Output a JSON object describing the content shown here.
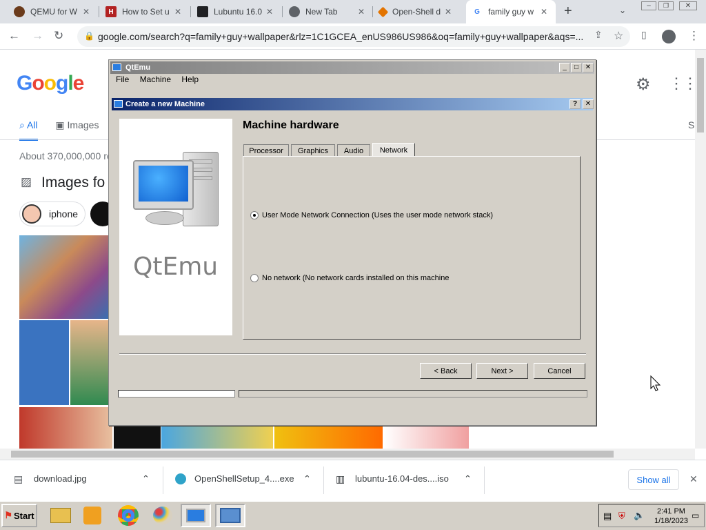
{
  "browser": {
    "tabs": [
      {
        "title": "QEMU for W",
        "fav_color": "#8b3a1a",
        "fav_char": ""
      },
      {
        "title": "How to Set u",
        "fav_color": "#b22222",
        "fav_char": "H"
      },
      {
        "title": "Lubuntu 16.0",
        "fav_color": "#202124",
        "fav_char": ""
      },
      {
        "title": "New Tab",
        "fav_color": "#5f6368",
        "fav_char": ""
      },
      {
        "title": "Open-Shell d",
        "fav_color": "#e37400",
        "fav_char": ""
      },
      {
        "title": "family guy w",
        "fav_color": "#4285f4",
        "fav_char": "G"
      }
    ],
    "url": "google.com/search?q=family+guy+wallpaper&rlz=1C1GCEA_enUS986US986&oq=family+guy+wallpaper&aqs=..."
  },
  "google": {
    "logo": "Google",
    "nav_all": "All",
    "nav_images": "Images",
    "nav_right": "S",
    "about": "About 370,000,000 re",
    "images_for": "Images fo",
    "chip": "iphone"
  },
  "downloads": {
    "items": [
      "download.jpg",
      "OpenShellSetup_4....exe",
      "lubuntu-16.04-des....iso"
    ],
    "show_all": "Show all"
  },
  "taskbar": {
    "start": "Start",
    "time": "2:41 PM",
    "date": "1/18/2023"
  },
  "qtemu": {
    "title": "QtEmu",
    "menu": [
      "File",
      "Machine",
      "Help"
    ]
  },
  "dialog": {
    "title": "Create a new Machine",
    "side_label": "QtEmu",
    "heading": "Machine hardware",
    "tabs": [
      "Processor",
      "Graphics",
      "Audio",
      "Network"
    ],
    "selected_tab": "Network",
    "options": [
      {
        "label": "User Mode Network Connection (Uses the user mode network stack)",
        "checked": true
      },
      {
        "label": "No network (No network cards installed on this machine",
        "checked": false
      }
    ],
    "back": "< Back",
    "next": "Next >",
    "cancel": "Cancel"
  }
}
